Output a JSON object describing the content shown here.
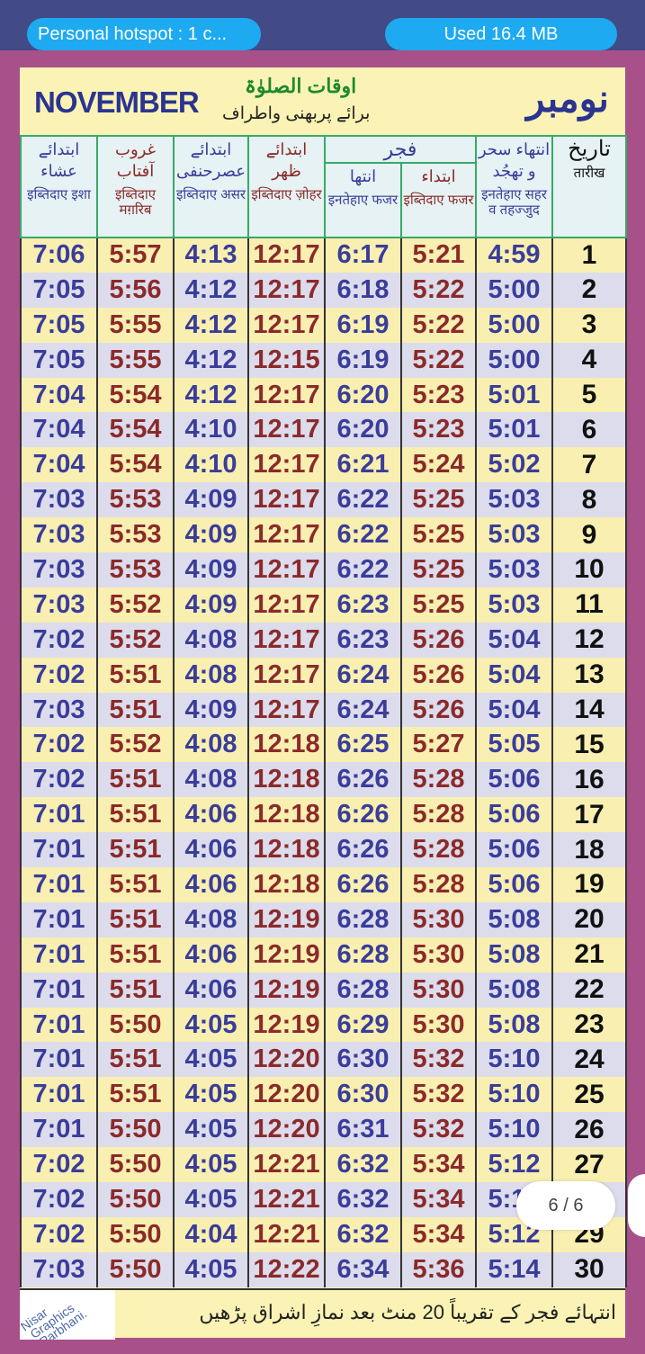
{
  "status_bar": {
    "hotspot": "Personal hotspot : 1 c...",
    "data_used": "Used  16.4 MB"
  },
  "header": {
    "month_en": "NOVEMBER",
    "title_ur": "اوقات الصلوٰۃ",
    "subtitle_ur": "برائے پربھنی واطراف",
    "month_ur": "نومبر"
  },
  "columns": [
    {
      "ur": "ابتدائے عشاء",
      "hi": "इब्तिदाए इशा",
      "color": "blue"
    },
    {
      "ur": "غروب آفتاب",
      "hi": "इब्तिदाए मग़रिब",
      "color": "red"
    },
    {
      "ur": "ابتدائے عصرحنفی",
      "hi": "इब्तिदाए असर",
      "color": "blue"
    },
    {
      "ur": "ابتدائے ظهر",
      "hi": "इब्तिदाए ज़ोहर",
      "color": "red"
    },
    {
      "ur": "انتها",
      "hi": "इनतेहाए फजर",
      "color": "blue"
    },
    {
      "ur": "ابتداء",
      "hi": "इब्तिदाए फजर",
      "color": "red"
    },
    {
      "ur": "انتهاء سحر و تهجُد",
      "hi": "इनतेहाए सहर व तहज्जुद",
      "color": "blue"
    },
    {
      "ur": "تاريخ",
      "hi": "तारीख",
      "color": "black"
    }
  ],
  "fajr_group_label": "فجر",
  "colors": {
    "blue": "#3a3d9a",
    "red": "#8b2a2a",
    "row_yellow": "#f8efb0",
    "row_lavender": "#dcdcec",
    "background": "#a8508a"
  },
  "rows": [
    [
      "7:06",
      "5:57",
      "4:13",
      "12:17",
      "6:17",
      "5:21",
      "4:59",
      "1"
    ],
    [
      "7:05",
      "5:56",
      "4:12",
      "12:17",
      "6:18",
      "5:22",
      "5:00",
      "2"
    ],
    [
      "7:05",
      "5:55",
      "4:12",
      "12:17",
      "6:19",
      "5:22",
      "5:00",
      "3"
    ],
    [
      "7:05",
      "5:55",
      "4:12",
      "12:15",
      "6:19",
      "5:22",
      "5:00",
      "4"
    ],
    [
      "7:04",
      "5:54",
      "4:12",
      "12:17",
      "6:20",
      "5:23",
      "5:01",
      "5"
    ],
    [
      "7:04",
      "5:54",
      "4:10",
      "12:17",
      "6:20",
      "5:23",
      "5:01",
      "6"
    ],
    [
      "7:04",
      "5:54",
      "4:10",
      "12:17",
      "6:21",
      "5:24",
      "5:02",
      "7"
    ],
    [
      "7:03",
      "5:53",
      "4:09",
      "12:17",
      "6:22",
      "5:25",
      "5:03",
      "8"
    ],
    [
      "7:03",
      "5:53",
      "4:09",
      "12:17",
      "6:22",
      "5:25",
      "5:03",
      "9"
    ],
    [
      "7:03",
      "5:53",
      "4:09",
      "12:17",
      "6:22",
      "5:25",
      "5:03",
      "10"
    ],
    [
      "7:03",
      "5:52",
      "4:09",
      "12:17",
      "6:23",
      "5:25",
      "5:03",
      "11"
    ],
    [
      "7:02",
      "5:52",
      "4:08",
      "12:17",
      "6:23",
      "5:26",
      "5:04",
      "12"
    ],
    [
      "7:02",
      "5:51",
      "4:08",
      "12:17",
      "6:24",
      "5:26",
      "5:04",
      "13"
    ],
    [
      "7:03",
      "5:51",
      "4:09",
      "12:17",
      "6:24",
      "5:26",
      "5:04",
      "14"
    ],
    [
      "7:02",
      "5:52",
      "4:08",
      "12:18",
      "6:25",
      "5:27",
      "5:05",
      "15"
    ],
    [
      "7:02",
      "5:51",
      "4:08",
      "12:18",
      "6:26",
      "5:28",
      "5:06",
      "16"
    ],
    [
      "7:01",
      "5:51",
      "4:06",
      "12:18",
      "6:26",
      "5:28",
      "5:06",
      "17"
    ],
    [
      "7:01",
      "5:51",
      "4:06",
      "12:18",
      "6:26",
      "5:28",
      "5:06",
      "18"
    ],
    [
      "7:01",
      "5:51",
      "4:06",
      "12:18",
      "6:26",
      "5:28",
      "5:06",
      "19"
    ],
    [
      "7:01",
      "5:51",
      "4:08",
      "12:19",
      "6:28",
      "5:30",
      "5:08",
      "20"
    ],
    [
      "7:01",
      "5:51",
      "4:06",
      "12:19",
      "6:28",
      "5:30",
      "5:08",
      "21"
    ],
    [
      "7:01",
      "5:51",
      "4:06",
      "12:19",
      "6:28",
      "5:30",
      "5:08",
      "22"
    ],
    [
      "7:01",
      "5:50",
      "4:05",
      "12:19",
      "6:29",
      "5:30",
      "5:08",
      "23"
    ],
    [
      "7:01",
      "5:51",
      "4:05",
      "12:20",
      "6:30",
      "5:32",
      "5:10",
      "24"
    ],
    [
      "7:01",
      "5:51",
      "4:05",
      "12:20",
      "6:30",
      "5:32",
      "5:10",
      "25"
    ],
    [
      "7:01",
      "5:50",
      "4:05",
      "12:20",
      "6:31",
      "5:32",
      "5:10",
      "26"
    ],
    [
      "7:02",
      "5:50",
      "4:05",
      "12:21",
      "6:32",
      "5:34",
      "5:12",
      "27"
    ],
    [
      "7:02",
      "5:50",
      "4:05",
      "12:21",
      "6:32",
      "5:34",
      "5:12",
      "28"
    ],
    [
      "7:02",
      "5:50",
      "4:04",
      "12:21",
      "6:32",
      "5:34",
      "5:12",
      "29"
    ],
    [
      "7:03",
      "5:50",
      "4:05",
      "12:22",
      "6:34",
      "5:36",
      "5:14",
      "30"
    ]
  ],
  "footer": {
    "brand": "Nisar Graphics Parbhani.",
    "note_ur": "انتہائے فجر کے تقریباً 20 منٹ بعد نمازِ اشراق پڑھیں"
  },
  "page_indicator": "6 / 6"
}
